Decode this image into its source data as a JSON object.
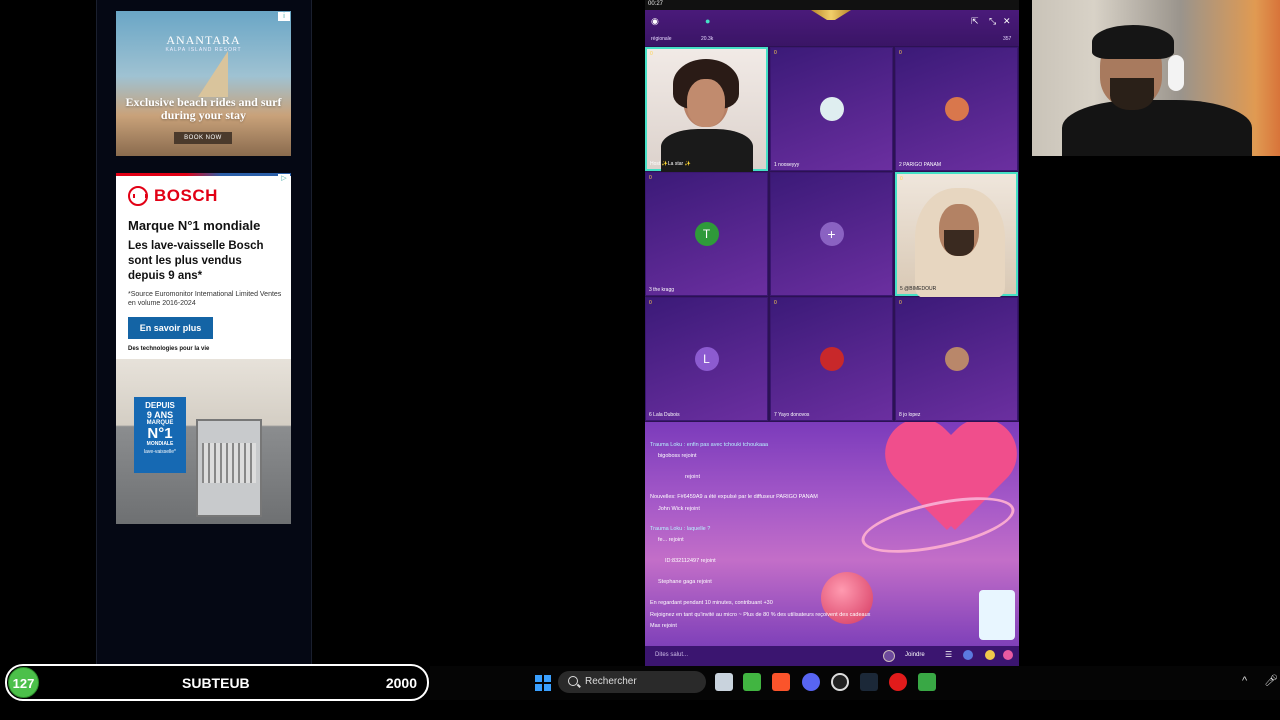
{
  "ads": {
    "anantara": {
      "brand": "ANANTARA",
      "subtitle": "KALPA ISLAND RESORT",
      "headline": "Exclusive beach rides and surf during your stay",
      "cta": "BOOK NOW"
    },
    "bosch": {
      "brand": "BOSCH",
      "heading": "Marque N°1 mondiale",
      "subheading": "Les lave-vaisselle Bosch sont les plus vendus depuis 9 ans*",
      "footnote": "*Source Euromonitor International Limited Ventes en volume 2016-2024",
      "cta": "En savoir plus",
      "tagline": "Des technologies pour la vie",
      "badge": {
        "line1": "DEPUIS",
        "line2": "9 ANS",
        "line3": "MARQUE",
        "line4": "N°1",
        "line5": "MONDIALE",
        "line6": "lave-vaisselle*"
      }
    }
  },
  "app": {
    "clock": "00:27",
    "region": "régionale",
    "count": "20.3k",
    "viewers": "357",
    "seats": [
      {
        "num": "0",
        "label": "Host ✨La star ✨"
      },
      {
        "num": "0",
        "label": "1 nooseyyy"
      },
      {
        "num": "0",
        "label": "2 PARIGO PANAM"
      },
      {
        "num": "0",
        "label": "3 the kragg",
        "initial": "T"
      },
      {
        "num": "",
        "label": ""
      },
      {
        "num": "0",
        "label": "5 @BIMEDOUR"
      },
      {
        "num": "0",
        "label": "6 Lala Dubois",
        "initial": "L"
      },
      {
        "num": "0",
        "label": "7 Yayo donovos"
      },
      {
        "num": "0",
        "label": "8 jo lopez"
      }
    ],
    "chat": [
      {
        "text": "Trauma Loku : enfin pas avec tchouki tchoukaaa"
      },
      {
        "text": "bigoboss rejoint"
      },
      {
        "text": "rejoint"
      },
      {
        "text": "Nouvelles: F#6459A9 a été expulsé par le diffuseur PARIGO PANAM"
      },
      {
        "text": "John Wick rejoint"
      },
      {
        "text": "Trauma Loku : laquelle ?"
      },
      {
        "text": "fe... rejoint"
      },
      {
        "text": "ID:832112497 rejoint"
      },
      {
        "text": "Stephane gaga rejoint"
      },
      {
        "text": "En regardant pendant 10 minutes, contribuant +30"
      },
      {
        "text": "Rejoignez en tant qu'invité au micro ~ Plus de 80 % des utilisateurs reçoivent des cadeaux"
      },
      {
        "text": "Max rejoint"
      }
    ],
    "input_placeholder": "Dites salut...",
    "join_label": "Joindre"
  },
  "subbar": {
    "count": "127",
    "name": "SUBTEUB",
    "goal": "2000"
  },
  "taskbar": {
    "search_placeholder": "Rechercher"
  },
  "colors": {
    "app_purple": "#2c1254",
    "accent_teal": "#45e0c6",
    "sub_green": "#4cc04a"
  }
}
